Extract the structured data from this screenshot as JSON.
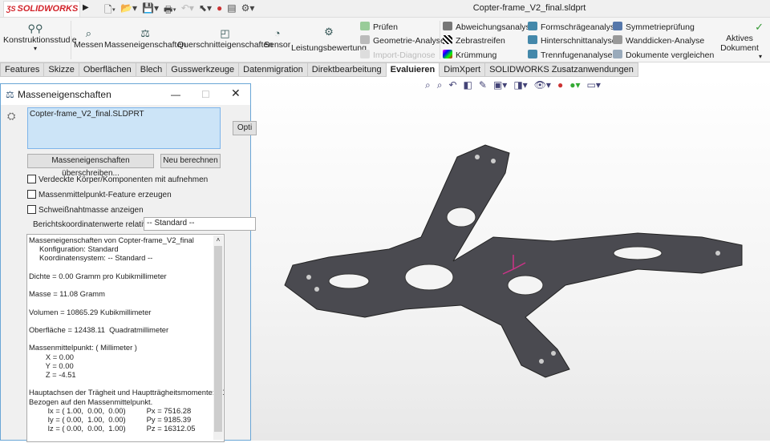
{
  "app": {
    "logo": "SOLIDWORKS",
    "doc_title": "Copter-frame_V2_final.sldprt"
  },
  "ribbon": {
    "large": [
      "Konstruktionsstudie",
      "Messen",
      "Masseneigenschaften",
      "Querschnitteigenschaften",
      "Sensor",
      "Leistungsbewertung",
      "Aktives Dokument"
    ],
    "col1": [
      "Prüfen",
      "Geometrie-Analyse",
      "Import-Diagnose"
    ],
    "col2": [
      "Abweichungsanalyse",
      "Zebrastreifen",
      "Krümmung"
    ],
    "col3": [
      "Formschrägeanalyse",
      "Hinterschnittanalyse",
      "Trennfugenanalyse"
    ],
    "col4": [
      "Symmetrieprüfung",
      "Wanddicken-Analyse",
      "Dokumente vergleichen"
    ]
  },
  "tabs": [
    "Features",
    "Skizze",
    "Oberflächen",
    "Blech",
    "Gusswerkzeuge",
    "Datenmigration",
    "Direktbearbeitung",
    "Evaluieren",
    "DimXpert",
    "SOLIDWORKS Zusatzanwendungen"
  ],
  "dialog": {
    "title": "Masseneigenschaften",
    "selected_file": "Copter-frame_V2_final.SLDPRT",
    "options_button": "Opti",
    "override_button": "Masseneigenschaften überschreiben...",
    "recalc_button": "Neu berechnen",
    "checkboxes": [
      "Verdeckte Körper/Komponenten mit aufnehmen",
      "Massenmittelpunkt-Feature erzeugen",
      "Schweißnahtmasse anzeigen"
    ],
    "coord_label": "Berichtskoordinatenwerte relativ zu:",
    "coord_value": "-- Standard --",
    "report": "Masseneigenschaften von Copter-frame_V2_final\n     Konfiguration: Standard\n     Koordinatensystem: -- Standard --\n\nDichte = 0.00 Gramm pro Kubikmillimeter\n\nMasse = 11.08 Gramm\n\nVolumen = 10865.29 Kubikmillimeter\n\nOberfläche = 12438.11  Quadratmillimeter\n\nMassenmittelpunkt: ( Millimeter )\n        X = 0.00\n        Y = 0.00\n        Z = -4.51\n\nHauptachsen der Trägheit und Hauptträgheitsmomente: ( Gramm\nBezogen auf den Massenmittelpunkt.\n         Ix = ( 1.00,  0.00,  0.00)          Px = 7516.28\n         Iy = ( 0.00,  1.00,  0.00)          Py = 9185.39\n         Iz = ( 0.00,  0.00,  1.00)          Pz = 16312.05"
  }
}
